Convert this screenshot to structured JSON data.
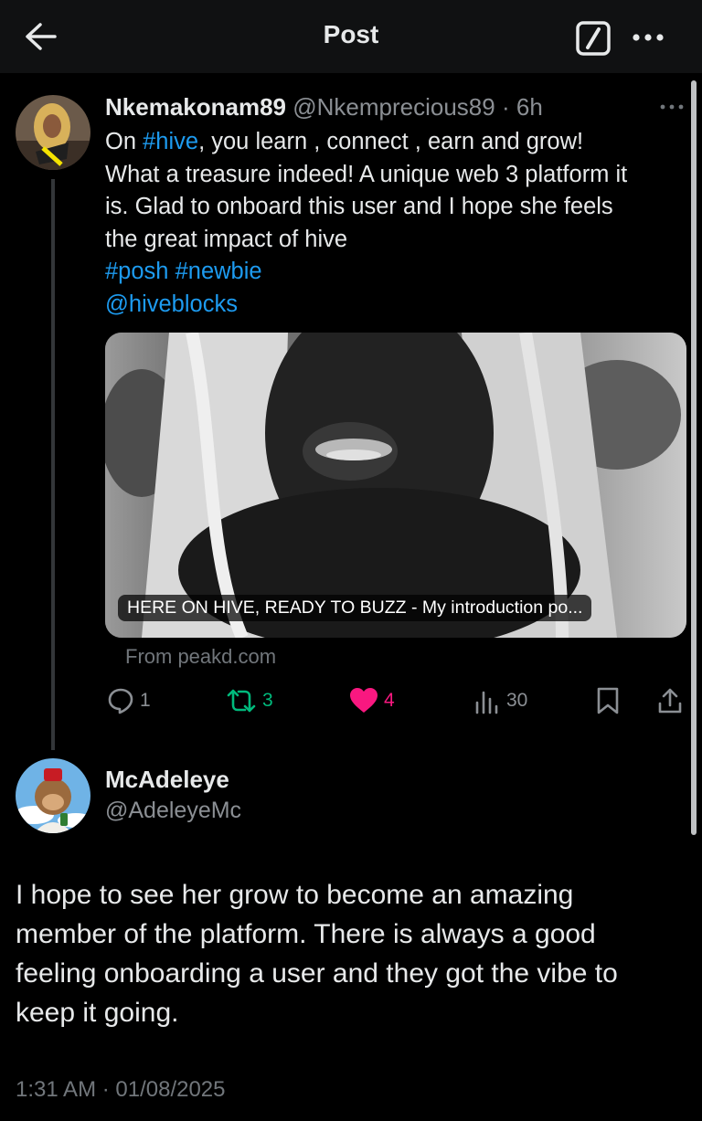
{
  "header": {
    "title": "Post",
    "back_icon": "arrow-left-icon",
    "grok_icon": "slash-square-icon",
    "more_icon": "more-horizontal-icon"
  },
  "post": {
    "author_name": "Nkemakonam89",
    "author_handle": "@Nkemprecious89",
    "separator": "·",
    "time": "6h",
    "body_lines": [
      [
        "On ",
        "#hive",
        ", you learn , connect , earn and grow!"
      ],
      "What a treasure indeed! A unique web 3 platform it",
      "is. Glad to onboard this user and I hope she feels",
      "the great impact of hive"
    ],
    "hashtag_posh": "#posh",
    "hashtag_newbie": "#newbie",
    "mention": "@hiveblocks",
    "card_caption": "HERE ON HIVE, READY TO BUZZ - My introduction po...",
    "card_source": "From peakd.com",
    "actions": {
      "replies": "1",
      "reposts": "3",
      "likes": "4",
      "views": "30"
    }
  },
  "reply": {
    "author_name": "McAdeleye",
    "author_handle": "@AdeleyeMc",
    "body_lines": [
      "I hope to see her grow to become an amazing",
      "member of the platform. There is always a good",
      "feeling onboarding a user and they got the vibe to",
      "keep it going."
    ],
    "timestamp": "1:31 AM · 01/08/2025"
  },
  "colors": {
    "accent": "#1d9bf0",
    "like": "#f91880",
    "repost": "#00ba7c",
    "muted": "#71767b"
  }
}
